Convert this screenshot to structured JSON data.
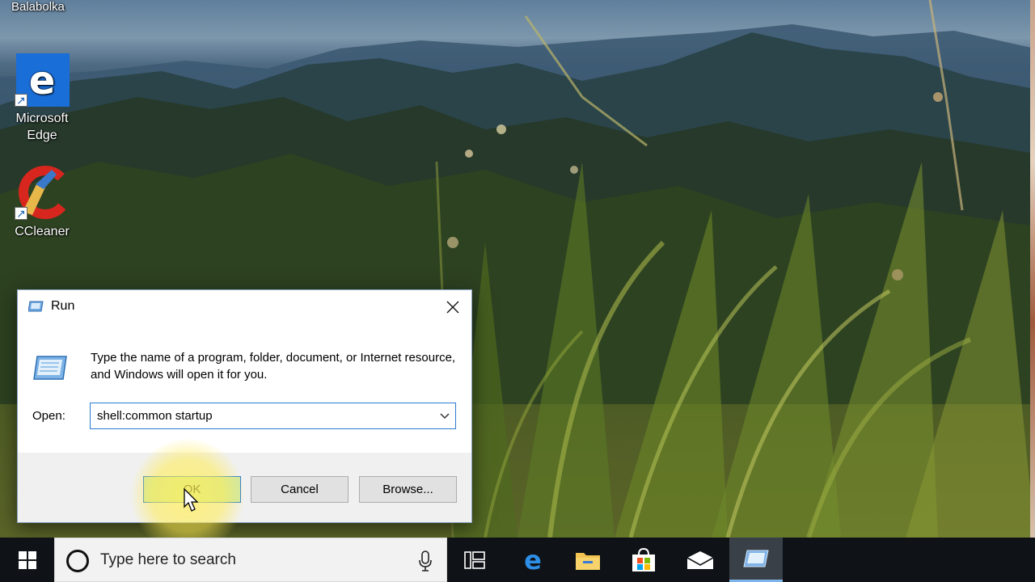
{
  "desktop": {
    "top_label": "Balabolka",
    "icons": [
      {
        "label_line1": "Microsoft",
        "label_line2": "Edge",
        "icon": "edge-icon"
      },
      {
        "label_line1": "CCleaner",
        "label_line2": "",
        "icon": "ccleaner-icon"
      }
    ]
  },
  "run_dialog": {
    "title": "Run",
    "description": "Type the name of a program, folder, document, or Internet resource, and Windows will open it for you.",
    "open_label": "Open:",
    "open_value": "shell:common startup",
    "buttons": {
      "ok": "OK",
      "cancel": "Cancel",
      "browse": "Browse..."
    }
  },
  "taskbar": {
    "search_placeholder": "Type here to search",
    "pinned": [
      "task-view-icon",
      "edge-icon",
      "file-explorer-icon",
      "store-icon",
      "mail-icon",
      "run-icon"
    ]
  },
  "colors": {
    "accent": "#2c7bd1",
    "ok_highlight": "#cfe8a8",
    "taskbar": "#0f1317"
  }
}
